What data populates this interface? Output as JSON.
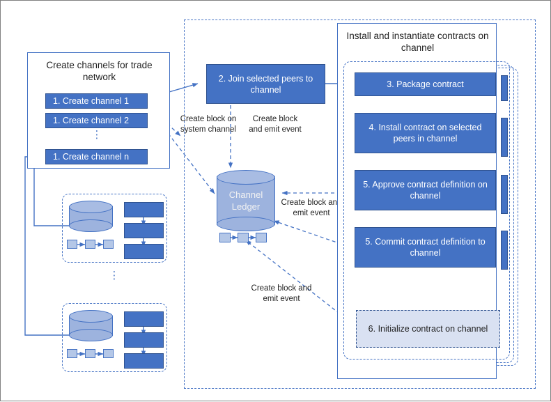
{
  "diagram": {
    "title_hidden": "",
    "left_panel": {
      "title": "Create channels for trade network",
      "channels": [
        {
          "label": "1. Create channel 1"
        },
        {
          "label": "1. Create channel 2"
        },
        {
          "label": "1. Create channel n"
        }
      ],
      "ellipsis": "⋮"
    },
    "peer_groups": [
      {
        "name": "peer-group-1",
        "ledger": "",
        "blocks": [
          "",
          "",
          ""
        ],
        "contracts": [
          "",
          "",
          ""
        ]
      },
      {
        "name": "peer-group-2",
        "ledger": "",
        "blocks": [
          "",
          "",
          ""
        ],
        "contracts": [
          "",
          "",
          ""
        ]
      }
    ],
    "group_ellipsis": "⋮",
    "join_step": {
      "label": "2. Join selected peers to channel"
    },
    "channel_ledger": {
      "line1": "Channel",
      "line2": "Ledger",
      "blocks": [
        "",
        "",
        ""
      ]
    },
    "right_panel": {
      "title": "Install and instantiate contracts on channel",
      "steps": [
        {
          "label": "3. Package contract"
        },
        {
          "label": "4. Install contract on selected peers in channel"
        },
        {
          "label": "5. Approve contract definition on channel"
        },
        {
          "label": "5. Commit contract definition to channel"
        }
      ],
      "final_step": {
        "label": "6. Initialize contract on channel"
      }
    },
    "edge_labels": {
      "create_block_on_system_channel": "Create block on system channel",
      "create_block_and_emit_event_top": "Create block and emit event",
      "create_block_and_emit_event_mid": "Create block and emit event",
      "create_block_and_emit_event_bottom": "Create block and emit event"
    },
    "colors": {
      "accent_blue": "#4472C4",
      "accent_blue_dark": "#2F528F",
      "light_fill": "#D9E1F2",
      "block_fill": "#B4C7E7",
      "cylinder_fill": "#9DB3DE",
      "page_border": "#808080",
      "text_dark": "#1F1F1F"
    }
  }
}
